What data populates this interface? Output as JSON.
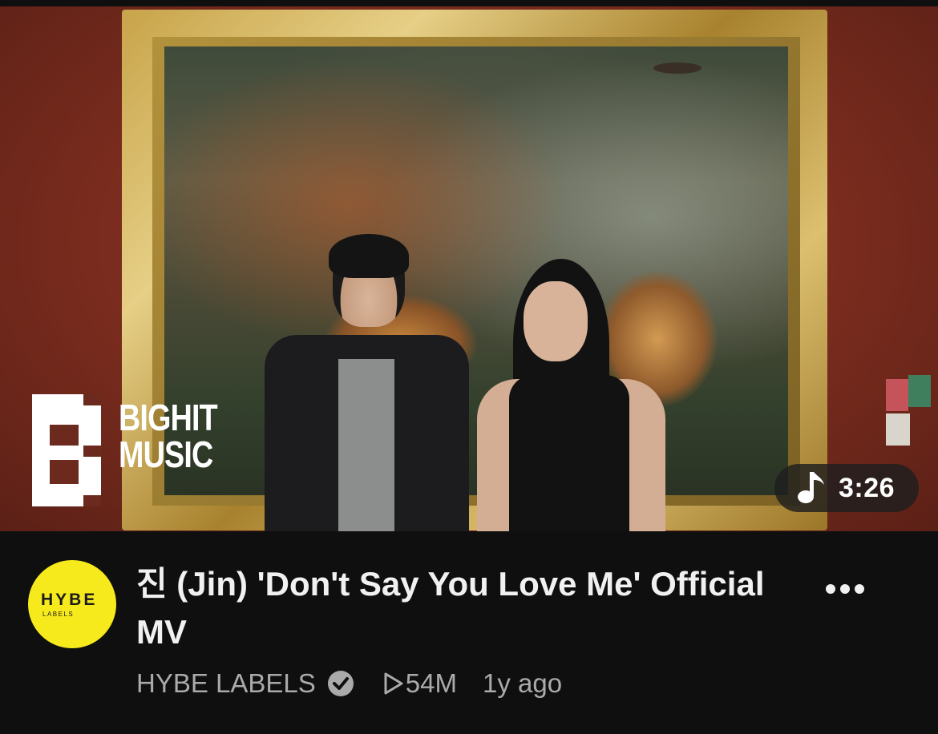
{
  "video": {
    "duration": "3:26",
    "watermark_line1": "BIGHIT",
    "watermark_line2": "MUSIC",
    "title": "진 (Jin) 'Don't Say You Love Me' Official MV",
    "channel": "HYBE LABELS",
    "views": "54M",
    "age": "1y ago"
  },
  "avatar": {
    "line1": "HYBE",
    "line2": "LABELS",
    "color": "#f7ea1c"
  },
  "icons": {
    "duration": "music-note-icon",
    "verified": "verified-check-icon",
    "views": "play-icon",
    "menu": "more-options-icon"
  }
}
